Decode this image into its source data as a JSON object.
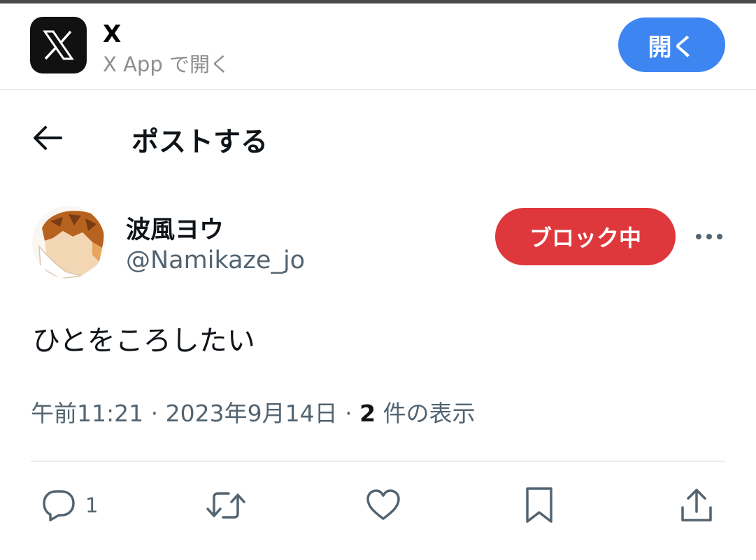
{
  "banner": {
    "app_name": "X",
    "subtitle": "X App で開く",
    "open_label": "開く"
  },
  "header": {
    "title": "ポストする"
  },
  "post": {
    "author_name": "波風ヨウ",
    "author_handle": "@Namikaze_jo",
    "block_label": "ブロック中",
    "text": "ひとをころしたい",
    "time": "午前11:21",
    "date": "2023年9月14日",
    "views_count": "2",
    "views_label": "件の表示",
    "separator": "·"
  },
  "actions": {
    "reply_count": "1",
    "icons": [
      "reply-icon",
      "repost-icon",
      "like-icon",
      "bookmark-icon",
      "share-icon"
    ]
  },
  "colors": {
    "open_button": "#3d86f2",
    "block_button": "#de383c",
    "secondary_text": "#536471"
  }
}
